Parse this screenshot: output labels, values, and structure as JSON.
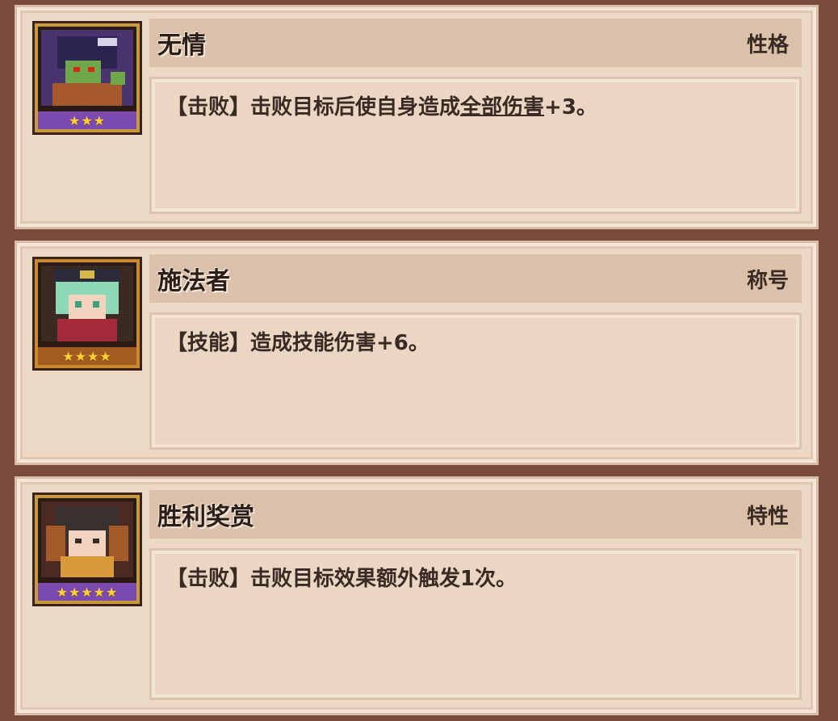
{
  "cards": [
    {
      "name": "无情",
      "tag": "性格",
      "desc_prefix": "【击败】击败目标后使自身造成",
      "desc_link": "全部伤害",
      "desc_suffix": "+3。",
      "stars": "★★★",
      "portrait": "purple-haired-green-skinned-character-icon",
      "colors": {
        "frame": "#8e63b8",
        "band": "#7a4ab0"
      }
    },
    {
      "name": "施法者",
      "tag": "称号",
      "desc_prefix": "【技能】造成技能伤害+6。",
      "desc_link": "",
      "desc_suffix": "",
      "stars": "★★★★",
      "portrait": "green-haired-hat-character-icon",
      "colors": {
        "frame": "#c17a2a",
        "band": "#a35b1f"
      }
    },
    {
      "name": "胜利奖赏",
      "tag": "特性",
      "desc_prefix": "【击败】击败目标效果额外触发1次。",
      "desc_link": "",
      "desc_suffix": "",
      "stars": "★★★★★",
      "portrait": "brown-haired-character-icon",
      "colors": {
        "frame": "#8e63b8",
        "band": "#7a4ab0"
      }
    }
  ]
}
